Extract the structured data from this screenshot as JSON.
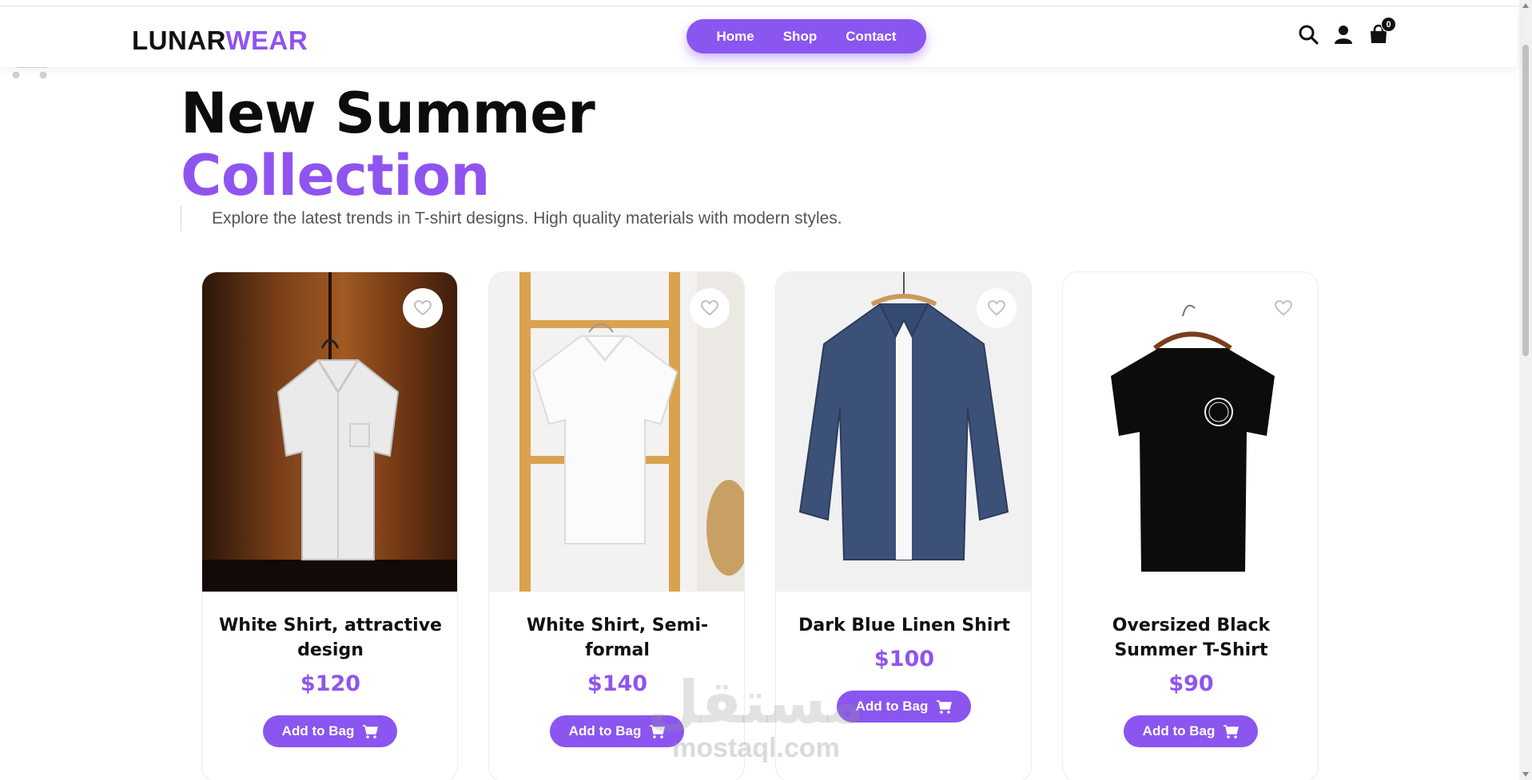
{
  "brand": {
    "part1": "LUNAR",
    "part2": "WEAR"
  },
  "nav": {
    "items": [
      "Home",
      "Shop",
      "Contact"
    ]
  },
  "cart": {
    "count": "0"
  },
  "icons": {
    "search": "search-icon",
    "user": "user-icon",
    "cart": "shopping-bag-icon",
    "heart": "heart-icon",
    "add_cart": "cart-icon"
  },
  "colors": {
    "accent": "#8b55f0",
    "text": "#111111",
    "subtext": "#555555"
  },
  "hero": {
    "title_line1": "New Summer",
    "title_line2": "Collection",
    "subtitle": "Explore the latest trends in T-shirt designs. High quality materials with modern styles."
  },
  "products": [
    {
      "name": "White Shirt, attractive design",
      "price": "$120",
      "button": "Add to Bag"
    },
    {
      "name": "White Shirt, Semi-formal",
      "price": "$140",
      "button": "Add to Bag"
    },
    {
      "name": "Dark Blue Linen Shirt",
      "price": "$100",
      "button": "Add to Bag"
    },
    {
      "name": "Oversized Black Summer T-Shirt",
      "price": "$90",
      "button": "Add to Bag"
    }
  ],
  "watermark": {
    "arabic": "مستقل",
    "latin": "mostaql.com"
  }
}
